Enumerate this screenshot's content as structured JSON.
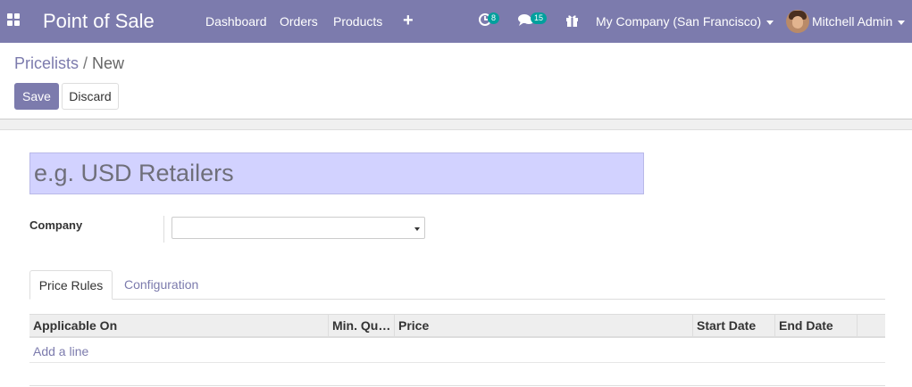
{
  "navbar": {
    "app_name": "Point of Sale",
    "menu": [
      {
        "label": "Dashboard"
      },
      {
        "label": "Orders"
      },
      {
        "label": "Products"
      }
    ],
    "quick_create_symbol": "+",
    "activity_badge": "8",
    "messages_badge": "15",
    "company": "My Company (San Francisco)",
    "user": "Mitchell Admin",
    "bg_color": "#7c7bad"
  },
  "breadcrumb": {
    "parent": "Pricelists",
    "separator": "/",
    "current": "New"
  },
  "buttons": {
    "save": "Save",
    "discard": "Discard"
  },
  "form": {
    "name_placeholder": "e.g. USD Retailers",
    "name_value": "",
    "company_label": "Company",
    "company_value": ""
  },
  "tabs": [
    {
      "label": "Price Rules",
      "active": true
    },
    {
      "label": "Configuration",
      "active": false
    }
  ],
  "table": {
    "columns": [
      "Applicable On",
      "Min. Quantity",
      "Price",
      "Start Date",
      "End Date"
    ],
    "add_line": "Add a line"
  }
}
